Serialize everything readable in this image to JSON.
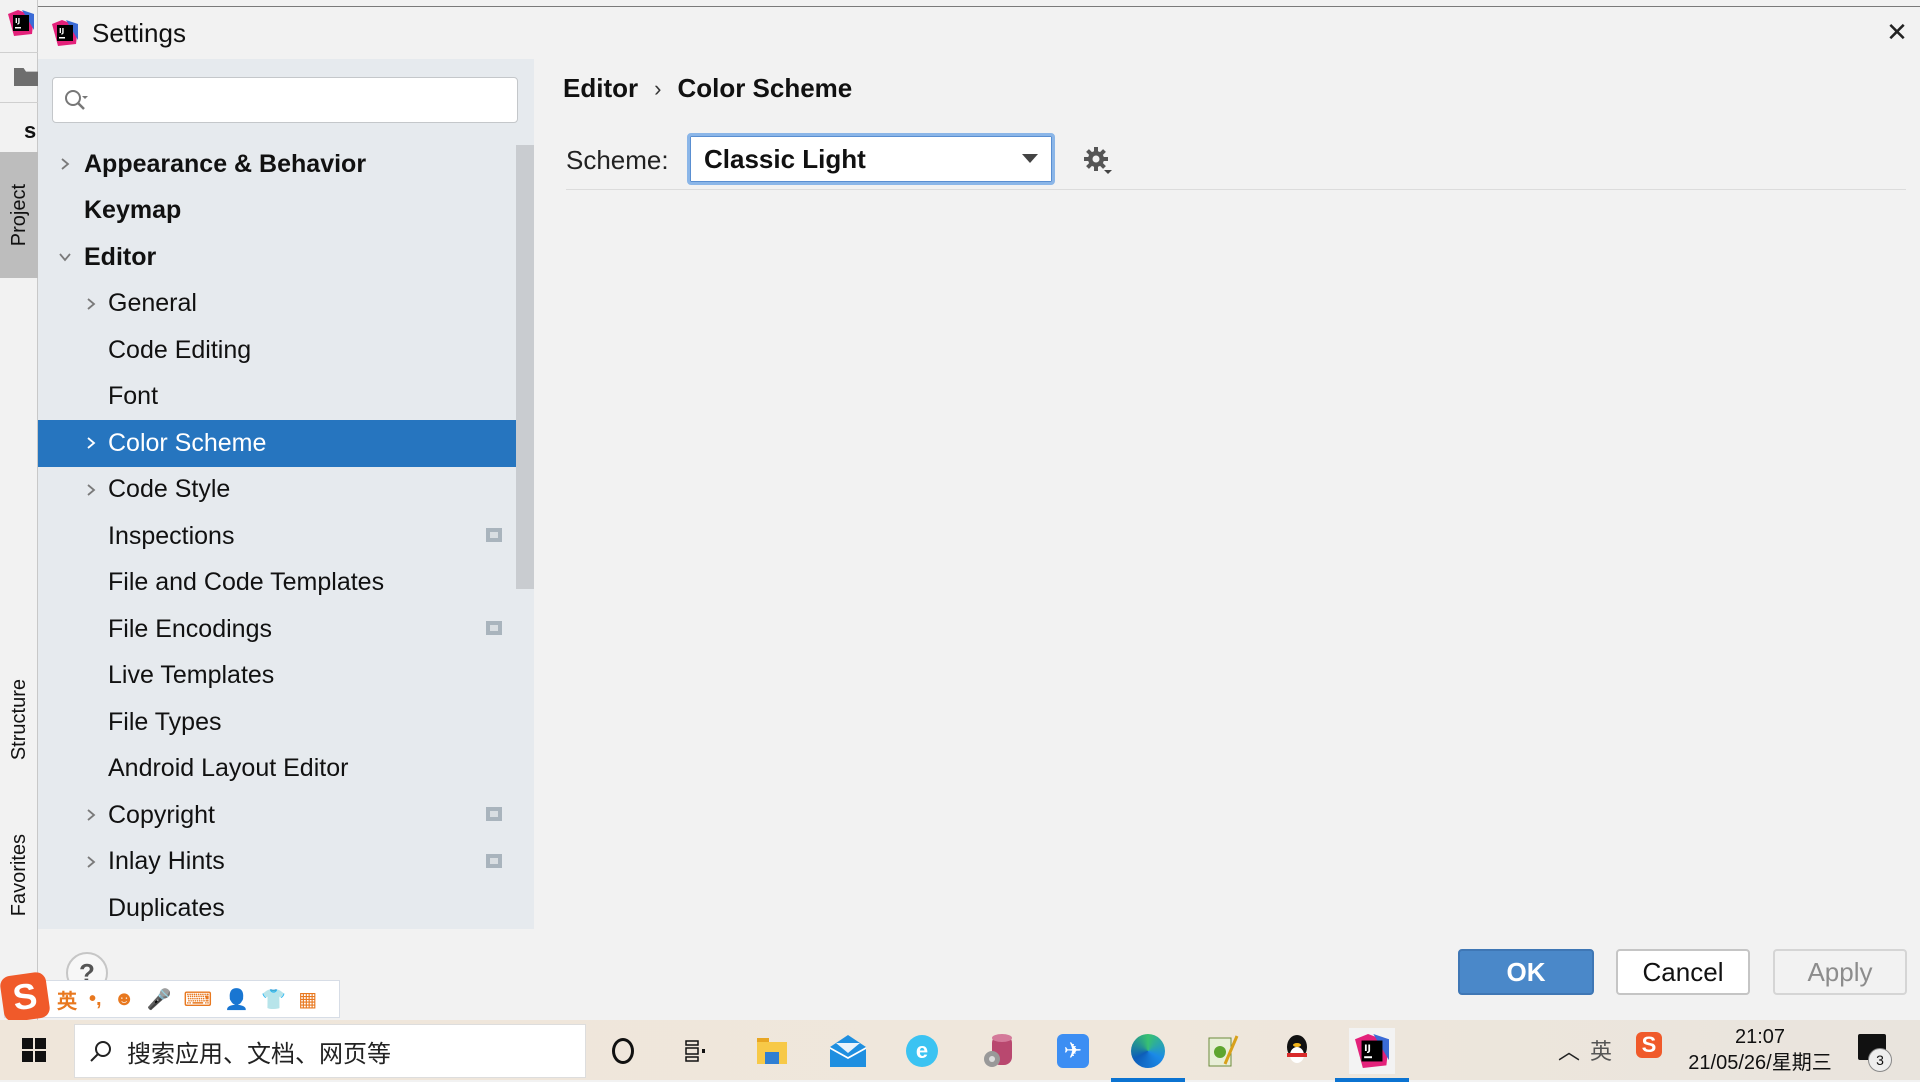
{
  "window": {
    "title": "Settings",
    "close_glyph": "✕"
  },
  "ide_strip": {
    "top_letter": "s",
    "tabs": [
      {
        "label": "Project",
        "active": true
      },
      {
        "label": "Structure",
        "active": false
      },
      {
        "label": "Favorites",
        "active": false
      }
    ]
  },
  "search": {
    "value": "",
    "placeholder": ""
  },
  "tree": [
    {
      "label": "Appearance & Behavior",
      "level": 0,
      "bold": true,
      "chevron": "right",
      "selected": false,
      "marker": false
    },
    {
      "label": "Keymap",
      "level": 0,
      "bold": true,
      "chevron": "none",
      "selected": false,
      "marker": false
    },
    {
      "label": "Editor",
      "level": 0,
      "bold": true,
      "chevron": "down",
      "selected": false,
      "marker": false
    },
    {
      "label": "General",
      "level": 1,
      "bold": false,
      "chevron": "right",
      "selected": false,
      "marker": false
    },
    {
      "label": "Code Editing",
      "level": 1,
      "bold": false,
      "chevron": "none",
      "selected": false,
      "marker": false
    },
    {
      "label": "Font",
      "level": 1,
      "bold": false,
      "chevron": "none",
      "selected": false,
      "marker": false
    },
    {
      "label": "Color Scheme",
      "level": 1,
      "bold": false,
      "chevron": "right",
      "selected": true,
      "marker": false
    },
    {
      "label": "Code Style",
      "level": 1,
      "bold": false,
      "chevron": "right",
      "selected": false,
      "marker": false
    },
    {
      "label": "Inspections",
      "level": 1,
      "bold": false,
      "chevron": "none",
      "selected": false,
      "marker": true
    },
    {
      "label": "File and Code Templates",
      "level": 1,
      "bold": false,
      "chevron": "none",
      "selected": false,
      "marker": false
    },
    {
      "label": "File Encodings",
      "level": 1,
      "bold": false,
      "chevron": "none",
      "selected": false,
      "marker": true
    },
    {
      "label": "Live Templates",
      "level": 1,
      "bold": false,
      "chevron": "none",
      "selected": false,
      "marker": false
    },
    {
      "label": "File Types",
      "level": 1,
      "bold": false,
      "chevron": "none",
      "selected": false,
      "marker": false
    },
    {
      "label": "Android Layout Editor",
      "level": 1,
      "bold": false,
      "chevron": "none",
      "selected": false,
      "marker": false
    },
    {
      "label": "Copyright",
      "level": 1,
      "bold": false,
      "chevron": "right",
      "selected": false,
      "marker": true
    },
    {
      "label": "Inlay Hints",
      "level": 1,
      "bold": false,
      "chevron": "right",
      "selected": false,
      "marker": true
    },
    {
      "label": "Duplicates",
      "level": 1,
      "bold": false,
      "chevron": "none",
      "selected": false,
      "marker": false
    }
  ],
  "content": {
    "breadcrumb": [
      "Editor",
      "Color Scheme"
    ],
    "breadcrumb_sep": "›",
    "scheme_label": "Scheme:",
    "scheme_value": "Classic Light"
  },
  "footer": {
    "help": "?",
    "ok": "OK",
    "cancel": "Cancel",
    "apply": "Apply",
    "apply_enabled": false
  },
  "ime": {
    "logo": "S",
    "items": [
      "英",
      "•,",
      "☻",
      "🎤",
      "⌨",
      "👤",
      "👕",
      "▦"
    ]
  },
  "taskbar": {
    "search_placeholder": "搜索应用、文档、网页等",
    "apps": [
      "cortana",
      "task-view",
      "file-explorer",
      "mail",
      "browser-e",
      "database-tool",
      "feishu",
      "edge",
      "notepad-plus",
      "qq",
      "intellij"
    ],
    "tray_ime": "英",
    "time": "21:07",
    "date": "21/05/26/星期三",
    "notification_count": "3"
  },
  "colors": {
    "selection": "#2675bf",
    "ok_button": "#4a88c9",
    "sidebar_bg": "#e6eaee"
  }
}
